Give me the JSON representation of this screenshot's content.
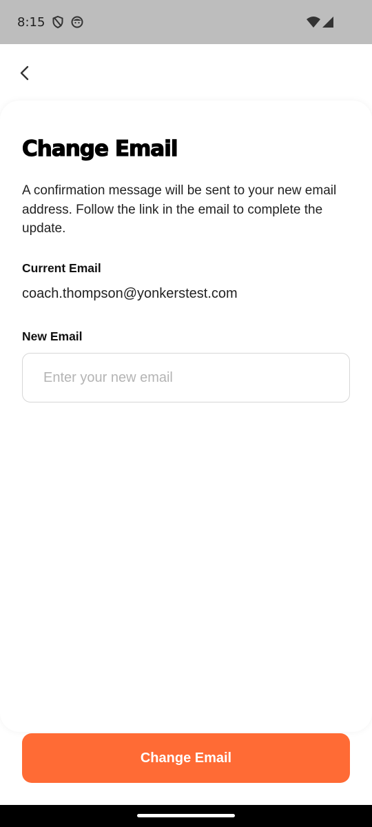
{
  "status_bar": {
    "time": "8:15",
    "left_icons": [
      "shield-icon",
      "face-icon"
    ],
    "right_icons": [
      "wifi-icon",
      "signal-icon"
    ]
  },
  "header": {
    "back_icon": "chevron-left-icon"
  },
  "content": {
    "title": "Change Email",
    "description": "A confirmation message will be sent to your new email address. Follow the link in the email to complete the update.",
    "current_email_label": "Current Email",
    "current_email_value": "coach.thompson@yonkerstest.com",
    "new_email_label": "New Email",
    "new_email_value": "",
    "new_email_placeholder": "Enter your new email"
  },
  "footer": {
    "submit_label": "Change Email"
  },
  "colors": {
    "accent": "#ff6b35",
    "status_bar": "#bdbdbd",
    "input_border": "#d6d6d6"
  }
}
